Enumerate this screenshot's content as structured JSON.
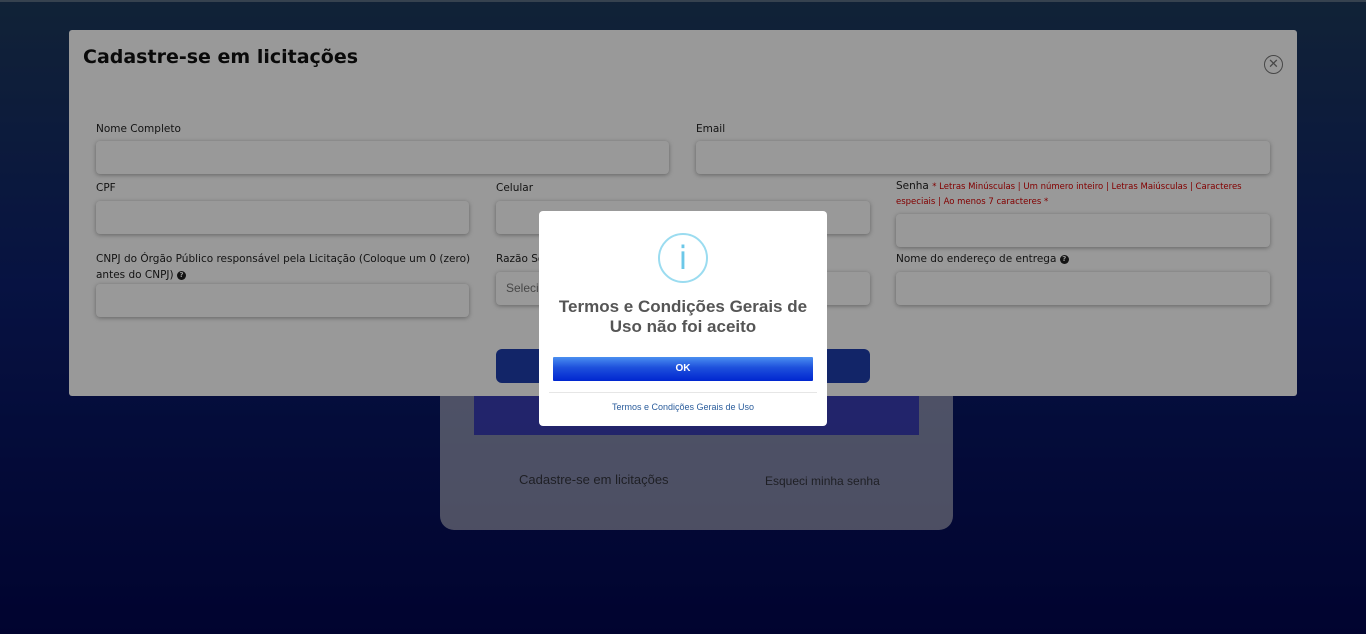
{
  "login": {
    "register_link": "Cadastre-se em licitações",
    "forgot_link": "Esqueci minha senha"
  },
  "register_modal": {
    "title": "Cadastre-se em licitações",
    "close_icon": "close-circle-icon",
    "fields": {
      "nome_label": "Nome Completo",
      "email_label": "Email",
      "cpf_label": "CPF",
      "celular_label": "Celular",
      "senha_label": "Senha",
      "senha_requirements": "* Letras Minúsculas | Um número inteiro | Letras Maiúsculas | Caracteres especiais | Ao menos 7 caracteres *",
      "cnpj_label": "CNPJ do Órgão Público responsável pela Licitação (Coloque um 0 (zero) antes do CNPJ)",
      "razao_label": "Razão So",
      "razao_select_value": "Selecio",
      "endereco_label": "Nome do endereço de entrega"
    }
  },
  "alert": {
    "icon": "info-icon",
    "icon_glyph": "i",
    "title": "Termos e Condições Gerais de Uso não foi aceito",
    "ok_label": "OK",
    "terms_link": "Termos e Condições Gerais de Uso"
  }
}
